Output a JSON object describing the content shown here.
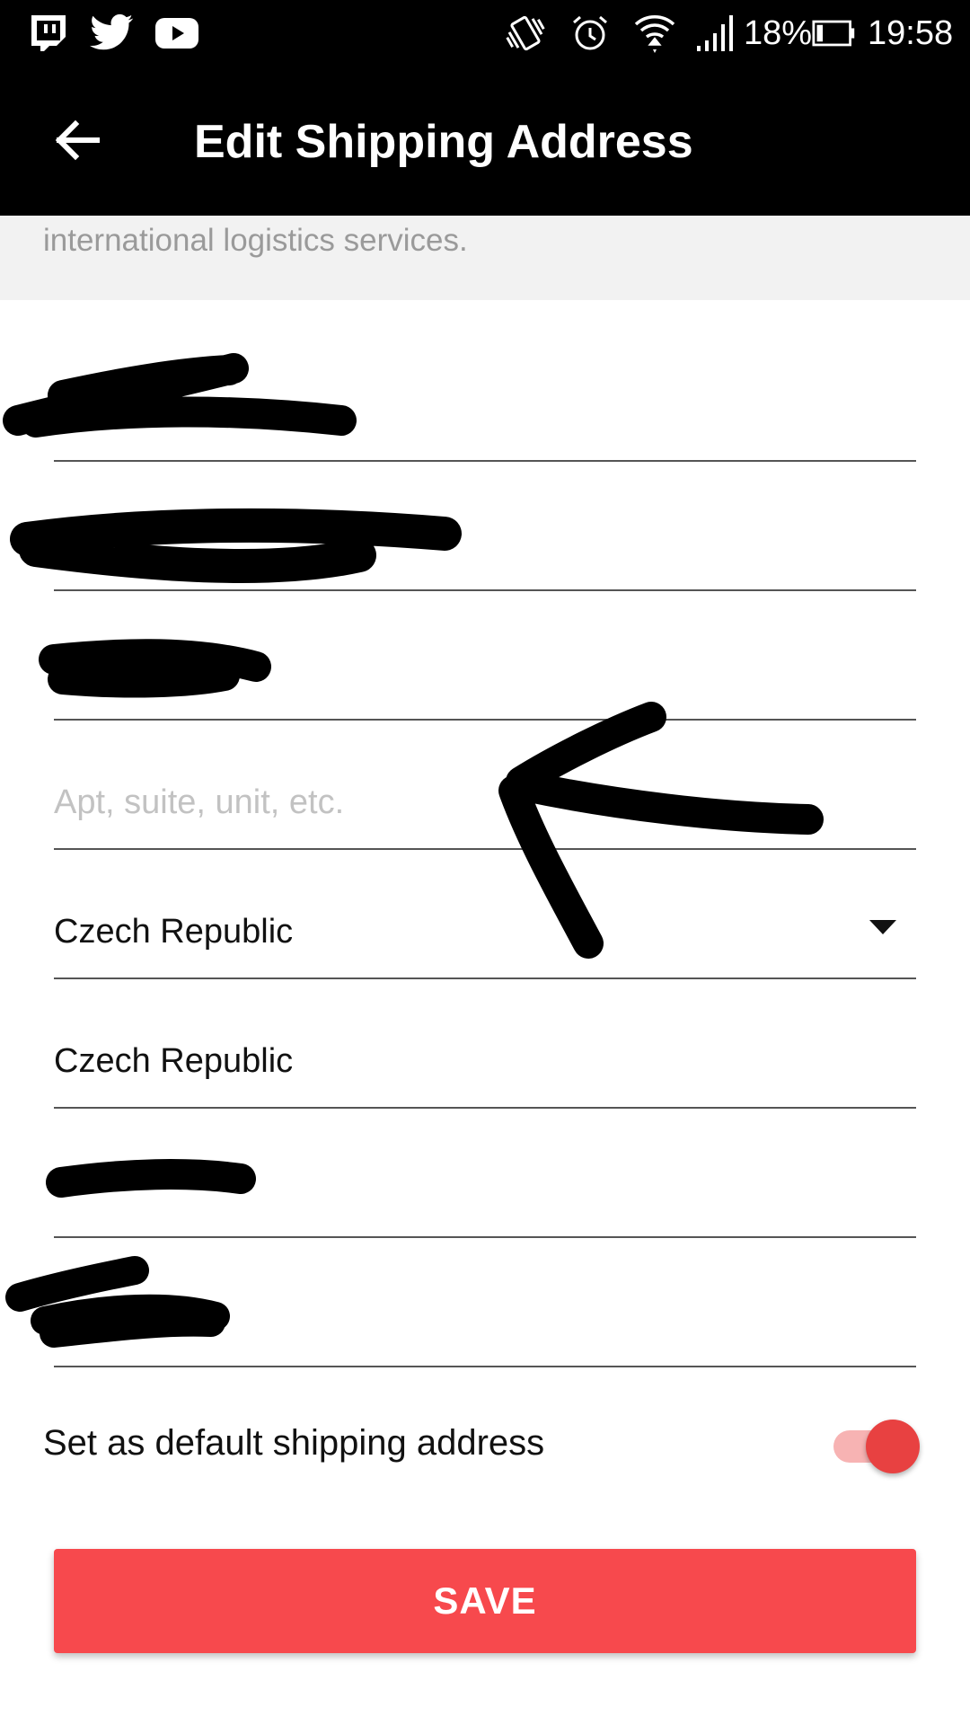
{
  "status_bar": {
    "icons": [
      "twitch-icon",
      "twitter-icon",
      "youtube-icon",
      "vibrate-icon",
      "alarm-icon",
      "wifi-icon",
      "signal-icon",
      "battery-icon"
    ],
    "battery_percent": "18%",
    "time": "19:58"
  },
  "app_bar": {
    "back_icon": "arrow-left-icon",
    "title": "Edit Shipping Address"
  },
  "info": {
    "text": "international logistics services."
  },
  "form": {
    "fields": [
      {
        "value": "",
        "placeholder": "",
        "redacted": true
      },
      {
        "value": "",
        "placeholder": "",
        "redacted": true
      },
      {
        "value": "",
        "placeholder": "",
        "redacted": true
      },
      {
        "value": "",
        "placeholder": "Apt, suite, unit, etc."
      },
      {
        "value": "Czech Republic",
        "type": "dropdown"
      },
      {
        "value": "Czech Republic"
      },
      {
        "value": "",
        "placeholder": "",
        "redacted": true
      },
      {
        "value": "",
        "placeholder": "",
        "redacted": true
      }
    ]
  },
  "default_toggle": {
    "label": "Set as default shipping address",
    "checked": true
  },
  "save_button": {
    "label": "SAVE"
  },
  "colors": {
    "accent": "#f7494d",
    "toggle_thumb": "#e84141",
    "toggle_track": "#f7b3b3",
    "header_bg": "#000000"
  }
}
